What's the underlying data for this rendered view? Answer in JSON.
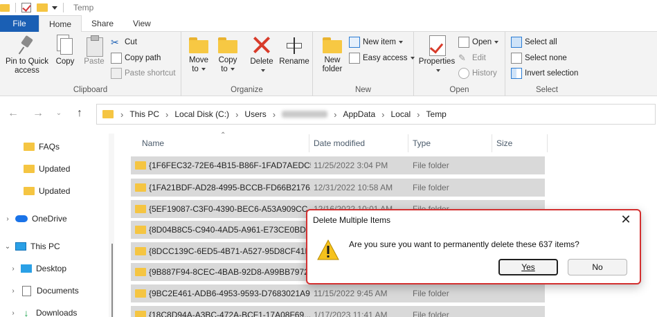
{
  "window": {
    "title": "Temp"
  },
  "ribbon_tabs": [
    "File",
    "Home",
    "Share",
    "View"
  ],
  "ribbon": {
    "clipboard": {
      "label": "Clipboard",
      "pin": "Pin to Quick access",
      "pin_line1": "Pin to Quick",
      "pin_line2": "access",
      "copy": "Copy",
      "paste": "Paste",
      "cut": "Cut",
      "copy_path": "Copy path",
      "paste_shortcut": "Paste shortcut"
    },
    "organize": {
      "label": "Organize",
      "move_to_1": "Move",
      "move_to_2": "to",
      "copy_to_1": "Copy",
      "copy_to_2": "to",
      "delete": "Delete",
      "rename": "Rename"
    },
    "new": {
      "label": "New",
      "new_folder_1": "New",
      "new_folder_2": "folder",
      "new_item": "New item",
      "easy_access": "Easy access"
    },
    "open": {
      "label": "Open",
      "properties": "Properties",
      "open": "Open",
      "edit": "Edit",
      "history": "History"
    },
    "select": {
      "label": "Select",
      "select_all": "Select all",
      "select_none": "Select none",
      "invert": "Invert selection"
    }
  },
  "address": {
    "crumbs": [
      "This PC",
      "Local Disk (C:)",
      "Users",
      "AppData",
      "Local",
      "Temp"
    ]
  },
  "navpane": {
    "items": [
      "FAQs",
      "Updated",
      "Updated",
      "OneDrive",
      "This PC",
      "Desktop",
      "Documents",
      "Downloads"
    ]
  },
  "filelist": {
    "columns": [
      "Name",
      "Date modified",
      "Type",
      "Size"
    ],
    "rows": [
      {
        "name": "{1F6FEC32-72E6-4B15-B86F-1FAD7AEDC5...",
        "date": "11/25/2022 3:04 PM",
        "type": "File folder"
      },
      {
        "name": "{1FA21BDF-AD28-4995-BCCB-FD66B2176...",
        "date": "12/31/2022 10:58 AM",
        "type": "File folder"
      },
      {
        "name": "{5EF19087-C3F0-4390-BEC6-A53A909CC...",
        "date": "12/16/2022 10:01 AM",
        "type": "File folder"
      },
      {
        "name": "{8D04B8C5-C940-4AD5-A961-E73CE0BD2...",
        "date": "",
        "type": ""
      },
      {
        "name": "{8DCC139C-6ED5-4B71-A527-95D8CF41D...",
        "date": "",
        "type": ""
      },
      {
        "name": "{9B887F94-8CEC-4BAB-92D8-A99BB7972...",
        "date": "",
        "type": ""
      },
      {
        "name": "{9BC2E461-ADB6-4953-9593-D7683021A9...",
        "date": "11/15/2022 9:45 AM",
        "type": "File folder"
      },
      {
        "name": "{18C8D94A-A3BC-472A-BCF1-17A08F69...",
        "date": "1/17/2023 11:41 AM",
        "type": "File folder"
      }
    ]
  },
  "dialog": {
    "title": "Delete Multiple Items",
    "message": "Are you sure you want to permanently delete these 637 items?",
    "yes": "Yes",
    "no": "No"
  },
  "colors": {
    "file_tab": "#1a5fb4",
    "dialog_border": "#d32f2f",
    "folder": "#f5c542",
    "selection": "#d9d9d9"
  }
}
